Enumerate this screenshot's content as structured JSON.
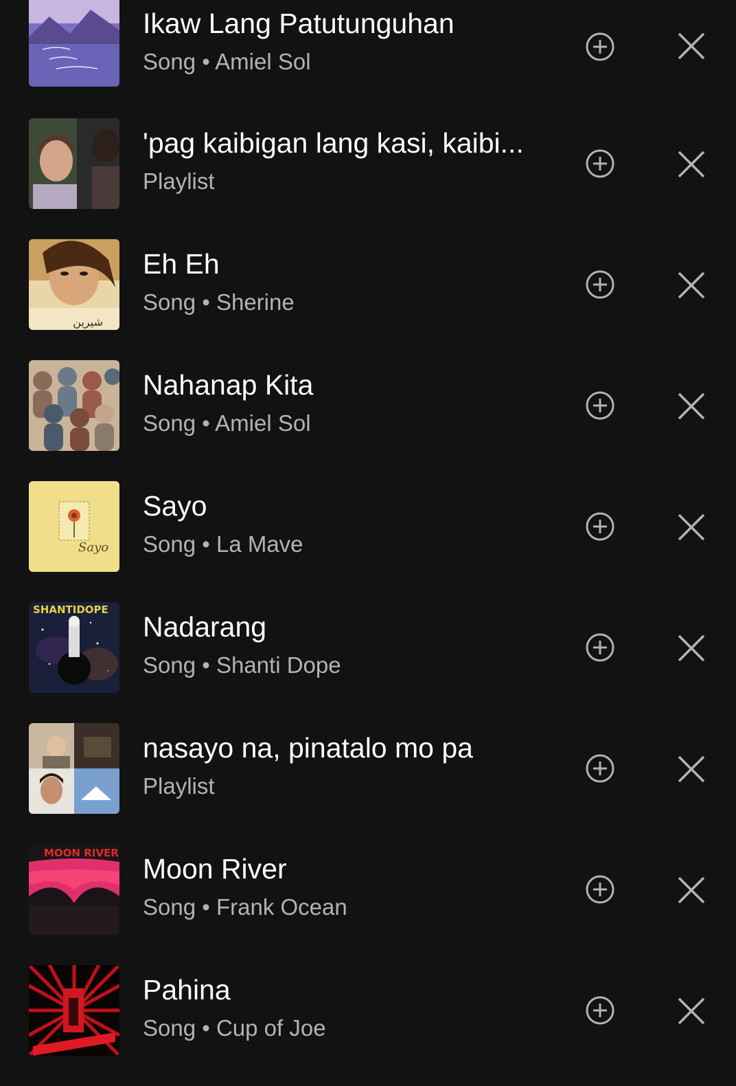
{
  "recent_searches": [
    {
      "title": "Ikaw Lang Patutunguhan",
      "type": "Song",
      "artist": "Amiel Sol",
      "subtitle": "Song • Amiel Sol",
      "art_icon": "album-art-lake-sunset"
    },
    {
      "title": "'pag kaibigan lang kasi, kaibi...",
      "type": "Playlist",
      "artist": "",
      "subtitle": "Playlist",
      "art_icon": "playlist-art-movie-still"
    },
    {
      "title": "Eh Eh",
      "type": "Song",
      "artist": "Sherine",
      "subtitle": "Song • Sherine",
      "art_icon": "album-art-portrait"
    },
    {
      "title": "Nahanap Kita",
      "type": "Song",
      "artist": "Amiel Sol",
      "subtitle": "Song • Amiel Sol",
      "art_icon": "album-art-crowd"
    },
    {
      "title": "Sayo",
      "type": "Song",
      "artist": "La Mave",
      "subtitle": "Song • La Mave",
      "art_icon": "album-art-flower-stamp"
    },
    {
      "title": "Nadarang",
      "type": "Song",
      "artist": "Shanti Dope",
      "subtitle": "Song • Shanti Dope",
      "art_icon": "album-art-space",
      "art_text": "SHANTIDOPE"
    },
    {
      "title": "nasayo na, pinatalo mo pa",
      "type": "Playlist",
      "artist": "",
      "subtitle": "Playlist",
      "art_icon": "playlist-art-collage"
    },
    {
      "title": "Moon River",
      "type": "Song",
      "artist": "Frank Ocean",
      "subtitle": "Song • Frank Ocean",
      "art_icon": "album-art-moon-river",
      "art_text": "MOON RIVER"
    },
    {
      "title": "Pahina",
      "type": "Song",
      "artist": "Cup of Joe",
      "subtitle": "Song • Cup of Joe",
      "art_icon": "album-art-red-burst"
    }
  ],
  "icons": {
    "add": "add-circle-icon",
    "remove": "close-icon"
  },
  "colors": {
    "background": "#121212",
    "title_text": "#ffffff",
    "subtitle_text": "#b3b3b3",
    "icon": "#b3b3b3"
  }
}
